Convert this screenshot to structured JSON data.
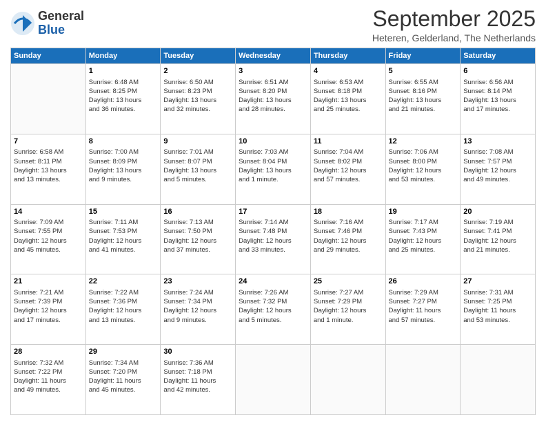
{
  "logo": {
    "general": "General",
    "blue": "Blue"
  },
  "title": "September 2025",
  "location": "Heteren, Gelderland, The Netherlands",
  "days_of_week": [
    "Sunday",
    "Monday",
    "Tuesday",
    "Wednesday",
    "Thursday",
    "Friday",
    "Saturday"
  ],
  "weeks": [
    [
      {
        "day": "",
        "info": ""
      },
      {
        "day": "1",
        "info": "Sunrise: 6:48 AM\nSunset: 8:25 PM\nDaylight: 13 hours\nand 36 minutes."
      },
      {
        "day": "2",
        "info": "Sunrise: 6:50 AM\nSunset: 8:23 PM\nDaylight: 13 hours\nand 32 minutes."
      },
      {
        "day": "3",
        "info": "Sunrise: 6:51 AM\nSunset: 8:20 PM\nDaylight: 13 hours\nand 28 minutes."
      },
      {
        "day": "4",
        "info": "Sunrise: 6:53 AM\nSunset: 8:18 PM\nDaylight: 13 hours\nand 25 minutes."
      },
      {
        "day": "5",
        "info": "Sunrise: 6:55 AM\nSunset: 8:16 PM\nDaylight: 13 hours\nand 21 minutes."
      },
      {
        "day": "6",
        "info": "Sunrise: 6:56 AM\nSunset: 8:14 PM\nDaylight: 13 hours\nand 17 minutes."
      }
    ],
    [
      {
        "day": "7",
        "info": "Sunrise: 6:58 AM\nSunset: 8:11 PM\nDaylight: 13 hours\nand 13 minutes."
      },
      {
        "day": "8",
        "info": "Sunrise: 7:00 AM\nSunset: 8:09 PM\nDaylight: 13 hours\nand 9 minutes."
      },
      {
        "day": "9",
        "info": "Sunrise: 7:01 AM\nSunset: 8:07 PM\nDaylight: 13 hours\nand 5 minutes."
      },
      {
        "day": "10",
        "info": "Sunrise: 7:03 AM\nSunset: 8:04 PM\nDaylight: 13 hours\nand 1 minute."
      },
      {
        "day": "11",
        "info": "Sunrise: 7:04 AM\nSunset: 8:02 PM\nDaylight: 12 hours\nand 57 minutes."
      },
      {
        "day": "12",
        "info": "Sunrise: 7:06 AM\nSunset: 8:00 PM\nDaylight: 12 hours\nand 53 minutes."
      },
      {
        "day": "13",
        "info": "Sunrise: 7:08 AM\nSunset: 7:57 PM\nDaylight: 12 hours\nand 49 minutes."
      }
    ],
    [
      {
        "day": "14",
        "info": "Sunrise: 7:09 AM\nSunset: 7:55 PM\nDaylight: 12 hours\nand 45 minutes."
      },
      {
        "day": "15",
        "info": "Sunrise: 7:11 AM\nSunset: 7:53 PM\nDaylight: 12 hours\nand 41 minutes."
      },
      {
        "day": "16",
        "info": "Sunrise: 7:13 AM\nSunset: 7:50 PM\nDaylight: 12 hours\nand 37 minutes."
      },
      {
        "day": "17",
        "info": "Sunrise: 7:14 AM\nSunset: 7:48 PM\nDaylight: 12 hours\nand 33 minutes."
      },
      {
        "day": "18",
        "info": "Sunrise: 7:16 AM\nSunset: 7:46 PM\nDaylight: 12 hours\nand 29 minutes."
      },
      {
        "day": "19",
        "info": "Sunrise: 7:17 AM\nSunset: 7:43 PM\nDaylight: 12 hours\nand 25 minutes."
      },
      {
        "day": "20",
        "info": "Sunrise: 7:19 AM\nSunset: 7:41 PM\nDaylight: 12 hours\nand 21 minutes."
      }
    ],
    [
      {
        "day": "21",
        "info": "Sunrise: 7:21 AM\nSunset: 7:39 PM\nDaylight: 12 hours\nand 17 minutes."
      },
      {
        "day": "22",
        "info": "Sunrise: 7:22 AM\nSunset: 7:36 PM\nDaylight: 12 hours\nand 13 minutes."
      },
      {
        "day": "23",
        "info": "Sunrise: 7:24 AM\nSunset: 7:34 PM\nDaylight: 12 hours\nand 9 minutes."
      },
      {
        "day": "24",
        "info": "Sunrise: 7:26 AM\nSunset: 7:32 PM\nDaylight: 12 hours\nand 5 minutes."
      },
      {
        "day": "25",
        "info": "Sunrise: 7:27 AM\nSunset: 7:29 PM\nDaylight: 12 hours\nand 1 minute."
      },
      {
        "day": "26",
        "info": "Sunrise: 7:29 AM\nSunset: 7:27 PM\nDaylight: 11 hours\nand 57 minutes."
      },
      {
        "day": "27",
        "info": "Sunrise: 7:31 AM\nSunset: 7:25 PM\nDaylight: 11 hours\nand 53 minutes."
      }
    ],
    [
      {
        "day": "28",
        "info": "Sunrise: 7:32 AM\nSunset: 7:22 PM\nDaylight: 11 hours\nand 49 minutes."
      },
      {
        "day": "29",
        "info": "Sunrise: 7:34 AM\nSunset: 7:20 PM\nDaylight: 11 hours\nand 45 minutes."
      },
      {
        "day": "30",
        "info": "Sunrise: 7:36 AM\nSunset: 7:18 PM\nDaylight: 11 hours\nand 42 minutes."
      },
      {
        "day": "",
        "info": ""
      },
      {
        "day": "",
        "info": ""
      },
      {
        "day": "",
        "info": ""
      },
      {
        "day": "",
        "info": ""
      }
    ]
  ]
}
